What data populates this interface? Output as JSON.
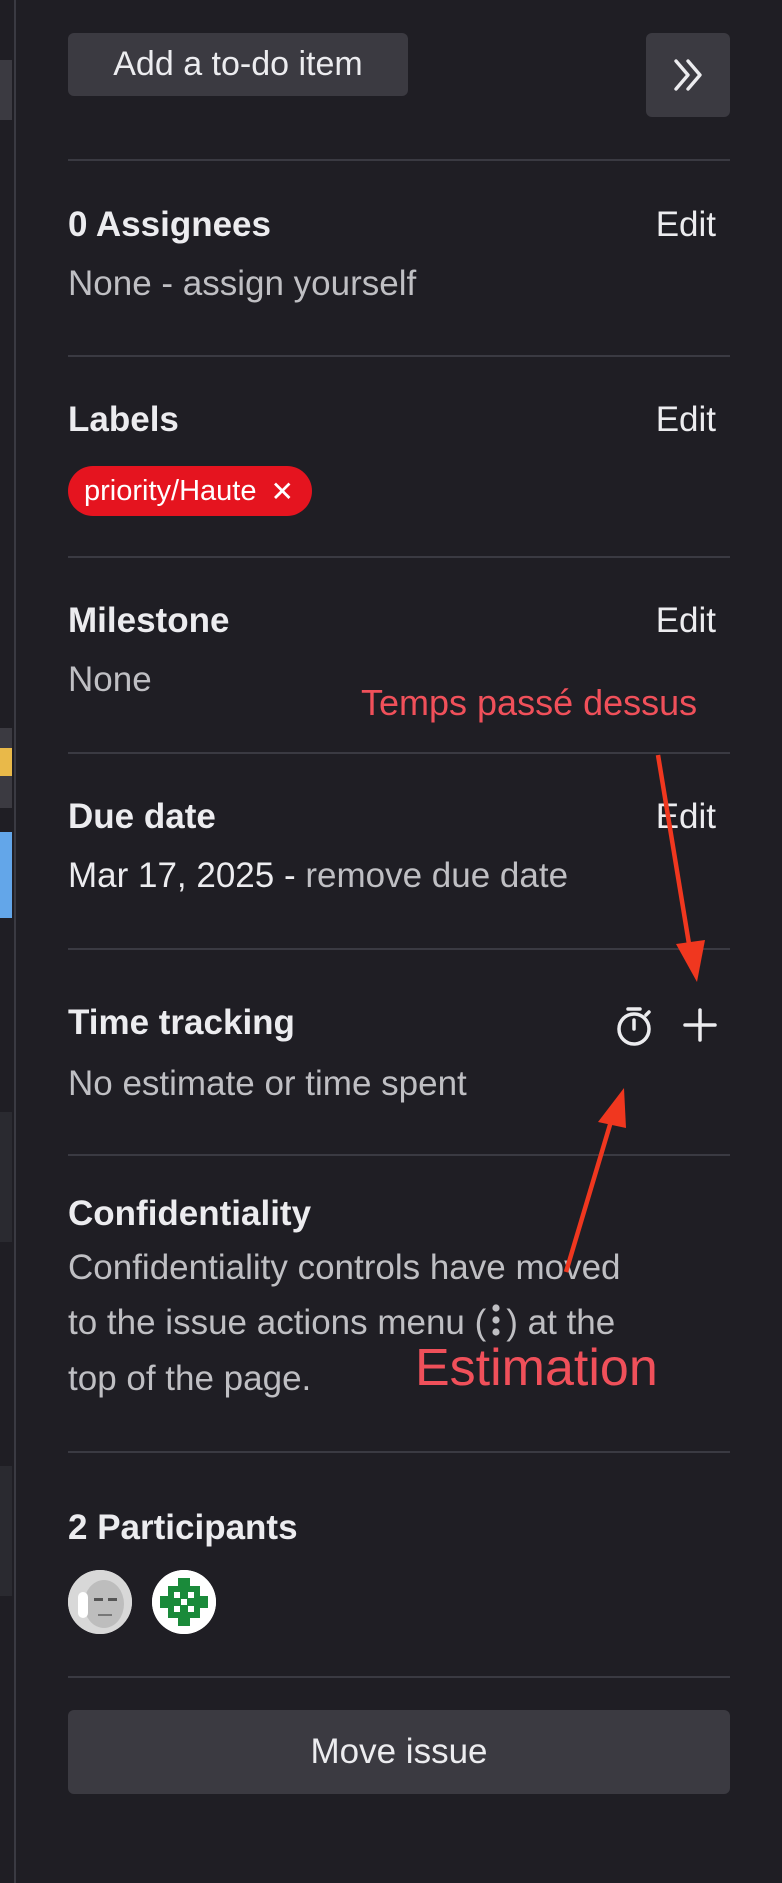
{
  "header": {
    "todo_label": "Add a to-do item",
    "collapse_icon": "chevron-double-right-icon"
  },
  "assignees": {
    "title": "0 Assignees",
    "edit_label": "Edit",
    "value": "None - assign yourself"
  },
  "labels": {
    "title": "Labels",
    "edit_label": "Edit",
    "items": [
      {
        "text": "priority/Haute",
        "color": "#e5141f"
      }
    ]
  },
  "milestone": {
    "title": "Milestone",
    "edit_label": "Edit",
    "value": "None"
  },
  "due_date": {
    "title": "Due date",
    "edit_label": "Edit",
    "date": "Mar 17, 2025",
    "separator": " - ",
    "remove_label": "remove due date"
  },
  "time_tracking": {
    "title": "Time tracking",
    "value": "No estimate or time spent",
    "icons": [
      "stopwatch-icon",
      "plus-icon"
    ]
  },
  "confidentiality": {
    "title": "Confidentiality",
    "line1": "Confidentiality controls have moved",
    "line2_pre": "to the issue actions menu (",
    "line2_post": ") at the",
    "line3": "top of the page."
  },
  "participants": {
    "title": "2 Participants"
  },
  "move_issue_label": "Move issue",
  "annotations": {
    "time_spent": "Temps passé dessus",
    "estimate": "Estimation",
    "color": "#f0505a"
  }
}
